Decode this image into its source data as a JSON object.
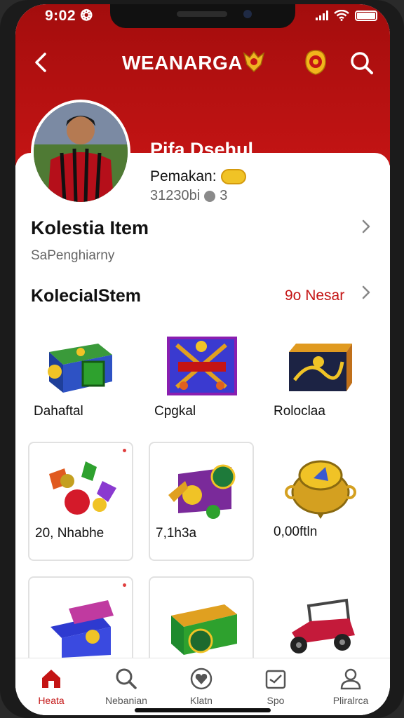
{
  "status": {
    "time": "9:02 ❂"
  },
  "header": {
    "title": "WEANARGA"
  },
  "profile": {
    "name": "Pifa Dsehul",
    "role": "Pemakan: ",
    "stats": "31230bi",
    "stats_suffix": "3"
  },
  "section1": {
    "title": "Kolestia Item",
    "subtitle": "SaPenghiarny"
  },
  "section2": {
    "title": "KolecialStem",
    "see_all": "9o Nesar"
  },
  "items": [
    {
      "label": "Dahaftal"
    },
    {
      "label": "Cpgkal"
    },
    {
      "label": "Roloclaa"
    },
    {
      "label": "20, Nhabhe"
    },
    {
      "label": "7,1h3a"
    },
    {
      "label": "0,00ftln"
    },
    {
      "label": ""
    },
    {
      "label": ""
    },
    {
      "label": ""
    }
  ],
  "tabs": [
    {
      "label": "Heata",
      "icon": "home-icon"
    },
    {
      "label": "Nebanian",
      "icon": "search-icon"
    },
    {
      "label": "Klatn",
      "icon": "heart-icon"
    },
    {
      "label": "Spo",
      "icon": "wallet-icon"
    },
    {
      "label": "Pliralrca",
      "icon": "person-icon"
    }
  ],
  "colors": {
    "brand": "#c41414",
    "brand_dark": "#a30d0d",
    "gold": "#f0c326"
  }
}
